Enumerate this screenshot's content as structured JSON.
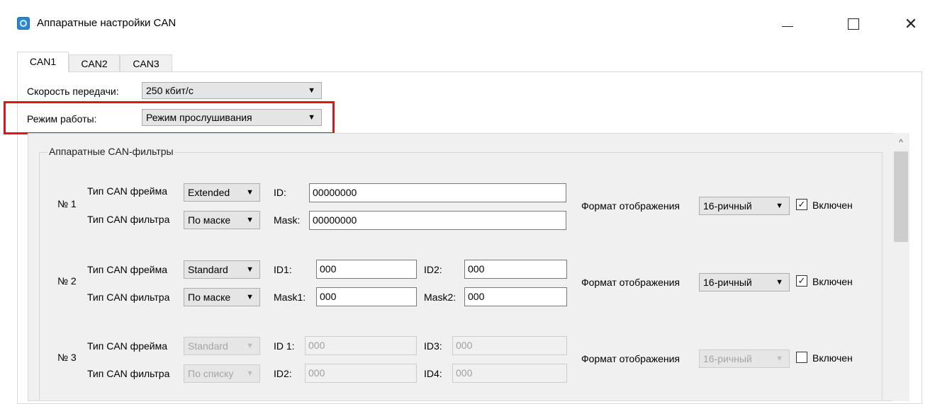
{
  "window": {
    "title": "Аппаратные настройки CAN",
    "minimize_icon": "minimize-icon",
    "maximize_icon": "maximize-icon",
    "close_glyph": "✕"
  },
  "tabs": [
    {
      "label": "CAN1",
      "active": true
    },
    {
      "label": "CAN2",
      "active": false
    },
    {
      "label": "CAN3",
      "active": false
    }
  ],
  "settings": {
    "speed_label": "Скорость передачи:",
    "speed_value": "250 кбит/с",
    "mode_label": "Режим работы:",
    "mode_value": "Режим прослушивания",
    "highlight_color": "#e3131a"
  },
  "filters": {
    "group_title": "Аппаратные CAN-фильтры",
    "items": [
      {
        "number": "№ 1",
        "frame_type_label": "Тип CAN фрейма",
        "frame_type_value": "Extended",
        "filter_type_label": "Тип CAN фильтра",
        "filter_type_value": "По маске",
        "id_label": "ID:",
        "id_value": "00000000",
        "mask_label": "Mask:",
        "mask_value": "00000000",
        "format_label": "Формат отображения",
        "format_value": "16-ричный",
        "enabled_label": "Включен",
        "enabled": true,
        "disabled": false
      },
      {
        "number": "№ 2",
        "frame_type_label": "Тип CAN фрейма",
        "frame_type_value": "Standard",
        "filter_type_label": "Тип CAN фильтра",
        "filter_type_value": "По маске",
        "id1_label": "ID1:",
        "id1_value": "000",
        "id2_label": "ID2:",
        "id2_value": "000",
        "mask1_label": "Mask1:",
        "mask1_value": "000",
        "mask2_label": "Mask2:",
        "mask2_value": "000",
        "format_label": "Формат отображения",
        "format_value": "16-ричный",
        "enabled_label": "Включен",
        "enabled": true,
        "disabled": false
      },
      {
        "number": "№ 3",
        "frame_type_label": "Тип CAN фрейма",
        "frame_type_value": "Standard",
        "filter_type_label": "Тип CAN фильтра",
        "filter_type_value": "По списку",
        "id1_label": "ID 1:",
        "id1_value": "000",
        "id3_label": "ID3:",
        "id3_value": "000",
        "id2_label": "ID2:",
        "id2_value": "000",
        "id4_label": "ID4:",
        "id4_value": "000",
        "format_label": "Формат отображения",
        "format_value": "16-ричный",
        "enabled_label": "Включен",
        "enabled": false,
        "disabled": true
      }
    ]
  },
  "icons": {
    "dropdown": "▼",
    "check": "✓",
    "scroll_up": "^"
  }
}
